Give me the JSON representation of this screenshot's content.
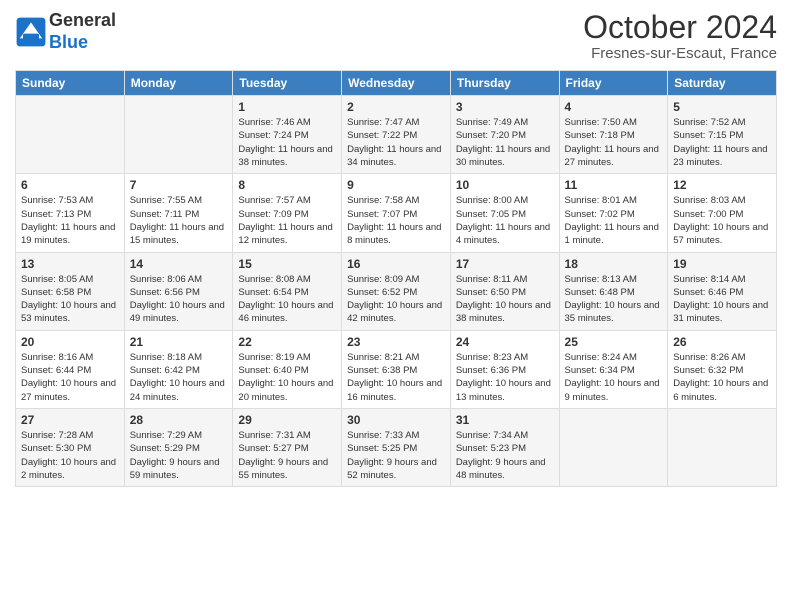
{
  "header": {
    "logo_line1": "General",
    "logo_line2": "Blue",
    "month": "October 2024",
    "location": "Fresnes-sur-Escaut, France"
  },
  "days_of_week": [
    "Sunday",
    "Monday",
    "Tuesday",
    "Wednesday",
    "Thursday",
    "Friday",
    "Saturday"
  ],
  "weeks": [
    [
      {
        "day": "",
        "sunrise": "",
        "sunset": "",
        "daylight": ""
      },
      {
        "day": "",
        "sunrise": "",
        "sunset": "",
        "daylight": ""
      },
      {
        "day": "1",
        "sunrise": "Sunrise: 7:46 AM",
        "sunset": "Sunset: 7:24 PM",
        "daylight": "Daylight: 11 hours and 38 minutes."
      },
      {
        "day": "2",
        "sunrise": "Sunrise: 7:47 AM",
        "sunset": "Sunset: 7:22 PM",
        "daylight": "Daylight: 11 hours and 34 minutes."
      },
      {
        "day": "3",
        "sunrise": "Sunrise: 7:49 AM",
        "sunset": "Sunset: 7:20 PM",
        "daylight": "Daylight: 11 hours and 30 minutes."
      },
      {
        "day": "4",
        "sunrise": "Sunrise: 7:50 AM",
        "sunset": "Sunset: 7:18 PM",
        "daylight": "Daylight: 11 hours and 27 minutes."
      },
      {
        "day": "5",
        "sunrise": "Sunrise: 7:52 AM",
        "sunset": "Sunset: 7:15 PM",
        "daylight": "Daylight: 11 hours and 23 minutes."
      }
    ],
    [
      {
        "day": "6",
        "sunrise": "Sunrise: 7:53 AM",
        "sunset": "Sunset: 7:13 PM",
        "daylight": "Daylight: 11 hours and 19 minutes."
      },
      {
        "day": "7",
        "sunrise": "Sunrise: 7:55 AM",
        "sunset": "Sunset: 7:11 PM",
        "daylight": "Daylight: 11 hours and 15 minutes."
      },
      {
        "day": "8",
        "sunrise": "Sunrise: 7:57 AM",
        "sunset": "Sunset: 7:09 PM",
        "daylight": "Daylight: 11 hours and 12 minutes."
      },
      {
        "day": "9",
        "sunrise": "Sunrise: 7:58 AM",
        "sunset": "Sunset: 7:07 PM",
        "daylight": "Daylight: 11 hours and 8 minutes."
      },
      {
        "day": "10",
        "sunrise": "Sunrise: 8:00 AM",
        "sunset": "Sunset: 7:05 PM",
        "daylight": "Daylight: 11 hours and 4 minutes."
      },
      {
        "day": "11",
        "sunrise": "Sunrise: 8:01 AM",
        "sunset": "Sunset: 7:02 PM",
        "daylight": "Daylight: 11 hours and 1 minute."
      },
      {
        "day": "12",
        "sunrise": "Sunrise: 8:03 AM",
        "sunset": "Sunset: 7:00 PM",
        "daylight": "Daylight: 10 hours and 57 minutes."
      }
    ],
    [
      {
        "day": "13",
        "sunrise": "Sunrise: 8:05 AM",
        "sunset": "Sunset: 6:58 PM",
        "daylight": "Daylight: 10 hours and 53 minutes."
      },
      {
        "day": "14",
        "sunrise": "Sunrise: 8:06 AM",
        "sunset": "Sunset: 6:56 PM",
        "daylight": "Daylight: 10 hours and 49 minutes."
      },
      {
        "day": "15",
        "sunrise": "Sunrise: 8:08 AM",
        "sunset": "Sunset: 6:54 PM",
        "daylight": "Daylight: 10 hours and 46 minutes."
      },
      {
        "day": "16",
        "sunrise": "Sunrise: 8:09 AM",
        "sunset": "Sunset: 6:52 PM",
        "daylight": "Daylight: 10 hours and 42 minutes."
      },
      {
        "day": "17",
        "sunrise": "Sunrise: 8:11 AM",
        "sunset": "Sunset: 6:50 PM",
        "daylight": "Daylight: 10 hours and 38 minutes."
      },
      {
        "day": "18",
        "sunrise": "Sunrise: 8:13 AM",
        "sunset": "Sunset: 6:48 PM",
        "daylight": "Daylight: 10 hours and 35 minutes."
      },
      {
        "day": "19",
        "sunrise": "Sunrise: 8:14 AM",
        "sunset": "Sunset: 6:46 PM",
        "daylight": "Daylight: 10 hours and 31 minutes."
      }
    ],
    [
      {
        "day": "20",
        "sunrise": "Sunrise: 8:16 AM",
        "sunset": "Sunset: 6:44 PM",
        "daylight": "Daylight: 10 hours and 27 minutes."
      },
      {
        "day": "21",
        "sunrise": "Sunrise: 8:18 AM",
        "sunset": "Sunset: 6:42 PM",
        "daylight": "Daylight: 10 hours and 24 minutes."
      },
      {
        "day": "22",
        "sunrise": "Sunrise: 8:19 AM",
        "sunset": "Sunset: 6:40 PM",
        "daylight": "Daylight: 10 hours and 20 minutes."
      },
      {
        "day": "23",
        "sunrise": "Sunrise: 8:21 AM",
        "sunset": "Sunset: 6:38 PM",
        "daylight": "Daylight: 10 hours and 16 minutes."
      },
      {
        "day": "24",
        "sunrise": "Sunrise: 8:23 AM",
        "sunset": "Sunset: 6:36 PM",
        "daylight": "Daylight: 10 hours and 13 minutes."
      },
      {
        "day": "25",
        "sunrise": "Sunrise: 8:24 AM",
        "sunset": "Sunset: 6:34 PM",
        "daylight": "Daylight: 10 hours and 9 minutes."
      },
      {
        "day": "26",
        "sunrise": "Sunrise: 8:26 AM",
        "sunset": "Sunset: 6:32 PM",
        "daylight": "Daylight: 10 hours and 6 minutes."
      }
    ],
    [
      {
        "day": "27",
        "sunrise": "Sunrise: 7:28 AM",
        "sunset": "Sunset: 5:30 PM",
        "daylight": "Daylight: 10 hours and 2 minutes."
      },
      {
        "day": "28",
        "sunrise": "Sunrise: 7:29 AM",
        "sunset": "Sunset: 5:29 PM",
        "daylight": "Daylight: 9 hours and 59 minutes."
      },
      {
        "day": "29",
        "sunrise": "Sunrise: 7:31 AM",
        "sunset": "Sunset: 5:27 PM",
        "daylight": "Daylight: 9 hours and 55 minutes."
      },
      {
        "day": "30",
        "sunrise": "Sunrise: 7:33 AM",
        "sunset": "Sunset: 5:25 PM",
        "daylight": "Daylight: 9 hours and 52 minutes."
      },
      {
        "day": "31",
        "sunrise": "Sunrise: 7:34 AM",
        "sunset": "Sunset: 5:23 PM",
        "daylight": "Daylight: 9 hours and 48 minutes."
      },
      {
        "day": "",
        "sunrise": "",
        "sunset": "",
        "daylight": ""
      },
      {
        "day": "",
        "sunrise": "",
        "sunset": "",
        "daylight": ""
      }
    ]
  ]
}
